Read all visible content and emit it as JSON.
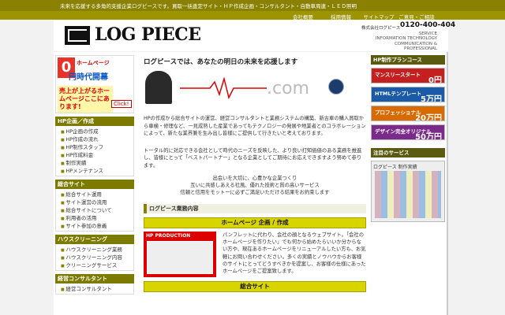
{
  "header": {
    "tagline": "未来を応援する多角的支援企業ログピースです。買取一括査定サイト・ＨＰ作成企画・コンサルタント・自動車周連・ＬＥＤ照明",
    "nav": [
      "会社概要",
      "採用情報",
      "サイトマップ",
      "ご意見・ご相談"
    ],
    "logo": "LOG PIECE",
    "company": "株式会社ログピース",
    "phone": "0120-400-404",
    "service_lines": [
      "SERVICE",
      "INFORMATION TECHNOLOGY",
      "COMMUNICATION & PROFESSIONAL"
    ]
  },
  "banner": {
    "zero": "0",
    "line1": "ホームページ",
    "line2": "円時代開幕",
    "line3": "売上が上がるホームページここにあります!",
    "click": "Click!"
  },
  "sidebar": {
    "sections": [
      {
        "title": "HP企画／作成",
        "items": [
          "HP企画の作成",
          "HP作成の流れ",
          "HP制作スタッフ",
          "HP作成料金",
          "制作実績",
          "HPメンテナンス"
        ]
      },
      {
        "title": "総合サイト",
        "items": [
          "総合サイト運用",
          "サイト運営の流用",
          "総合サイトについて",
          "利用者の活用",
          "サイト参加の意義"
        ]
      },
      {
        "title": "ハウスクリーニング",
        "items": [
          "ハウスクリーニング業務",
          "ハウスクリーニング内容",
          "クリーニングサービス"
        ]
      },
      {
        "title": "経営コンサルタント",
        "items": [
          "経営コンサルタント"
        ]
      }
    ]
  },
  "main": {
    "title": "ログピースでは、あなたの明日の未来を応援します",
    "dotcom": ".com",
    "para1": "HPの作成から総合サイトの運営、経営コンサルタントと業務システムの構築、新古車の購入買取から車検・修理など、一見成熟した産業であってもテクノロジーの発展や地業者とのコラボレーションによって、新たな業界兼を生み出し皆様にご提供して行きたいと考えております。",
    "para2": "トータル的に対応できる会社として時代のニーズを反映した、より良い打知価値のある業務を推進し、皆様にとって「ベストパートナー」となる企業としてご期待にお応えできますよう努めて参ります。",
    "center_lines": [
      "出会いを大切に、心豊かな企業つくり",
      "互いに共感しあえる社風、優れた技術と質の高いサービス",
      "信頼と信用をモットーに必ずご満足いただける結果をお約束します"
    ],
    "biz_head": "ログピース業務内容",
    "sub1": "ホームページ 企画 / 作成",
    "thumb_label": "HP PRODUCTION",
    "desc": "パンフレットに代わり、会社の顔となるウェブサイト。「会社のホームページを作りたい」でも何から始めたらいいか分からない方や、現在あるホームページをリニューアルしたい方も、お気軽にお問い合わせください。多くの実績とノウハウからお客様のサイトにとってどうすべきかを提案し、お客様の仕様にあったホームページをご提案致します。",
    "sub2": "総合サイト"
  },
  "right": {
    "plan_head": "HP制作プランコース",
    "plans": [
      {
        "name": "マンスリースタート",
        "price": "0円",
        "color": "#c42020"
      },
      {
        "name": "HTMLテンプレート",
        "price": "5万円",
        "color": "#1a5aa8"
      },
      {
        "name": "プロフェッショナル",
        "price": "20万円",
        "color": "#d86a00"
      },
      {
        "name": "デザイン完全オリジナル",
        "price": "50万円",
        "color": "#7a2a8a"
      }
    ],
    "service_head": "注目のサービス",
    "works_label": "ログピース 制作実績"
  }
}
